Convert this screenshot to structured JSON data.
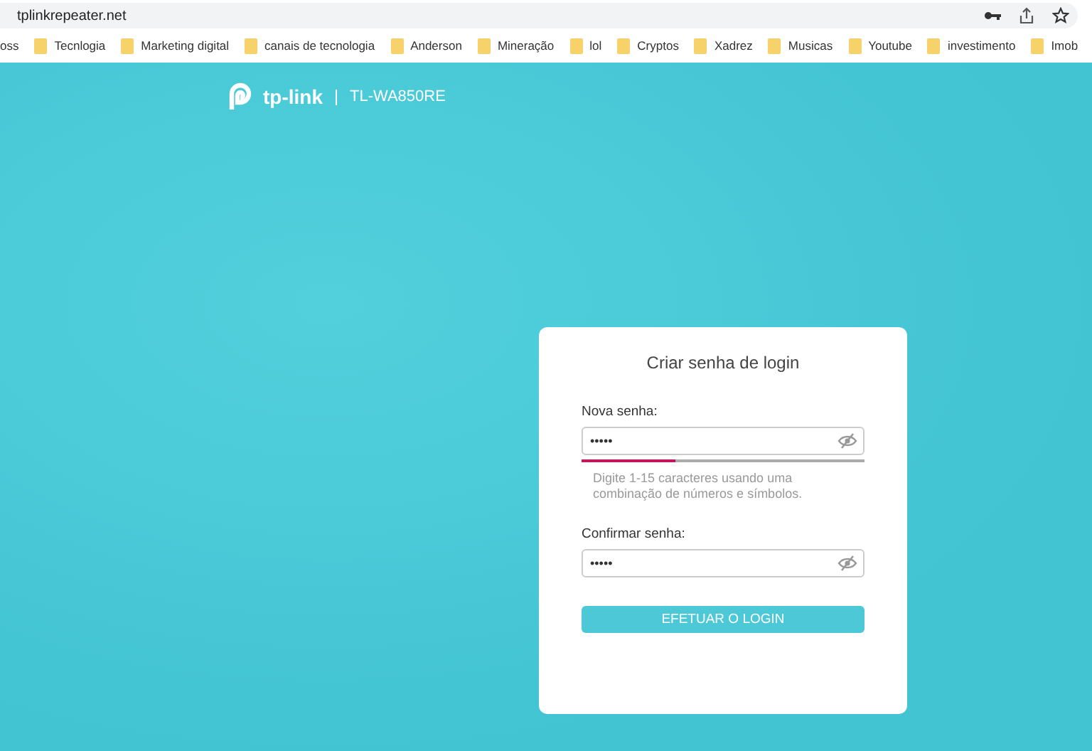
{
  "browser": {
    "url": "tplinkrepeater.net",
    "bookmarks": [
      {
        "label": "oss",
        "folder": false
      },
      {
        "label": "Tecnlogia",
        "folder": true
      },
      {
        "label": "Marketing digital",
        "folder": true
      },
      {
        "label": "canais de tecnologia",
        "folder": true
      },
      {
        "label": "Anderson",
        "folder": true
      },
      {
        "label": "Mineração",
        "folder": true
      },
      {
        "label": "lol",
        "folder": true
      },
      {
        "label": "Cryptos",
        "folder": true
      },
      {
        "label": "Xadrez",
        "folder": true
      },
      {
        "label": "Musicas",
        "folder": true
      },
      {
        "label": "Youtube",
        "folder": true
      },
      {
        "label": "investimento",
        "folder": true
      },
      {
        "label": "Imob",
        "folder": true
      }
    ]
  },
  "header": {
    "brand": "tp-link",
    "model": "TL-WA850RE"
  },
  "card": {
    "title": "Criar senha de login",
    "fields": [
      {
        "label": "Nova senha:",
        "value": "•••••",
        "strength": {
          "level": 0.33
        },
        "hint": "Digite 1-15 caracteres usando uma combinação de números e símbolos."
      },
      {
        "label": "Confirmar senha:",
        "value": "•••••"
      }
    ],
    "button": "EFETUAR O LOGIN"
  }
}
